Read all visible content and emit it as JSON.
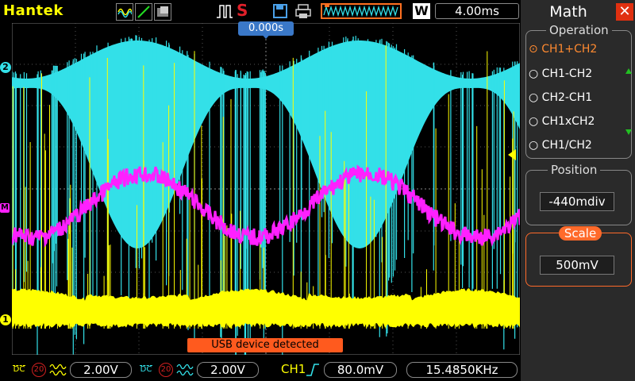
{
  "brand": "Hantek",
  "topbar": {
    "run_state": "S",
    "timebase": "4.00ms",
    "trigger_position": "0.000s",
    "w_label": "W"
  },
  "display": {
    "status_message": "USB device detected",
    "ch1_marker": "1",
    "ch2_marker": "2",
    "math_marker": "M"
  },
  "bottom": {
    "ch1": {
      "coupling": "DC",
      "bw_limit": "20",
      "scale": "2.00V"
    },
    "ch2": {
      "coupling": "DC",
      "bw_limit": "20",
      "scale": "2.00V"
    },
    "trigger_source": "CH1",
    "trigger_level": "80.0mV",
    "frequency": "15.4850KHz"
  },
  "panel": {
    "title": "Math",
    "operation_title": "Operation",
    "operations": [
      {
        "label": "CH1+CH2",
        "selected": true
      },
      {
        "label": "CH1-CH2",
        "selected": false
      },
      {
        "label": "CH2-CH1",
        "selected": false
      },
      {
        "label": "CH1xCH2",
        "selected": false
      },
      {
        "label": "CH1/CH2",
        "selected": false
      }
    ],
    "position_title": "Position",
    "position_value": "-440mdiv",
    "scale_title": "Scale",
    "scale_value": "500mV"
  },
  "colors": {
    "ch1": "#ffff00",
    "ch2": "#33e0e8",
    "math": "#ff20ff",
    "accent": "#ff6a2a",
    "trigger_label": "#3a78c8"
  }
}
